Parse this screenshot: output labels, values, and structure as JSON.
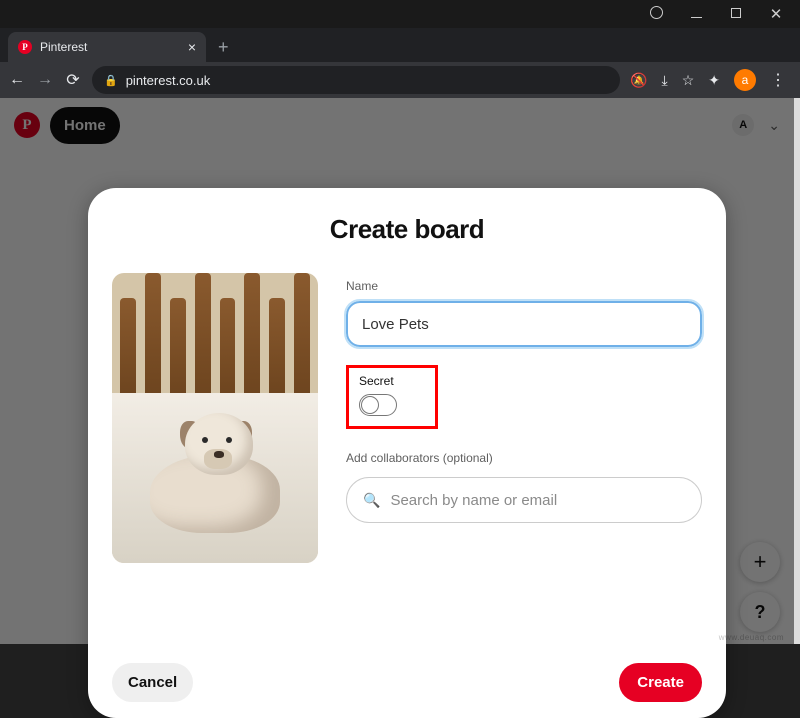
{
  "window": {
    "minimize": "minimize",
    "maximize": "maximize",
    "close": "close"
  },
  "browser": {
    "tab_title": "Pinterest",
    "tab_favicon_letter": "P",
    "tab_close": "×",
    "new_tab": "+",
    "address": "pinterest.co.uk",
    "avatar_letter": "a"
  },
  "pinterest_header": {
    "logo_letter": "P",
    "home": "Home",
    "avatar_letter": "A"
  },
  "fab": {
    "plus": "+",
    "help": "?"
  },
  "modal": {
    "title": "Create board",
    "name_label": "Name",
    "name_value": "Love Pets",
    "secret_label": "Secret",
    "secret_on": false,
    "collaborators_label": "Add collaborators (optional)",
    "collaborators_placeholder": "Search by name or email",
    "cancel": "Cancel",
    "create": "Create",
    "preview_alt": "bulldog puppy on bed"
  },
  "watermark": "www.deuaq.com"
}
